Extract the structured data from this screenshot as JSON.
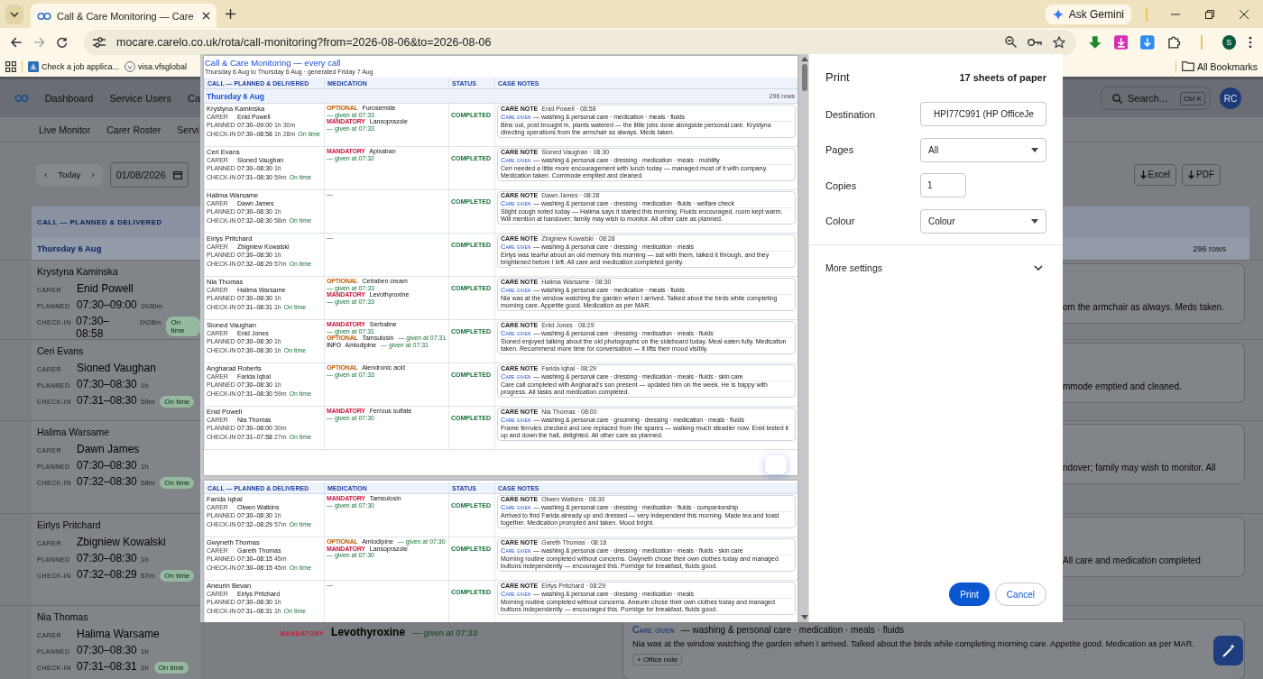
{
  "browser": {
    "tab_title": "Call & Care Monitoring — Care",
    "url": "mocare.carelo.co.uk/rota/call-monitoring?from=2026-08-06&to=2026-08-06",
    "ask_gemini": "Ask Gemini",
    "profile_initial": "S",
    "bookmarks": [
      "Check a job applica...",
      "visa.vfsglobal"
    ],
    "all_bookmarks": "All Bookmarks"
  },
  "app": {
    "nav": [
      "Dashboard",
      "Service Users",
      "Ca"
    ],
    "search": {
      "placeholder": "Search...",
      "shortcut": "Ctrl K"
    },
    "avatar": "RC",
    "subnav": [
      "Live Monitor",
      "Carer Roster",
      "Servi"
    ],
    "toolbar": {
      "prev": "‹",
      "today": "Today",
      "next": "›",
      "date": "01/08/2026",
      "exports": [
        "Excel",
        "PDF"
      ]
    },
    "column_header": "CALL — PLANNED & DELIVERED",
    "group": {
      "label": "Thursday 6 Aug",
      "count": "296 rows"
    },
    "rows": [
      {
        "client": "Krystyna Kaminska",
        "lines": [
          {
            "label": "CARER",
            "value": "Enid Powell"
          },
          {
            "label": "PLANNED",
            "value": "07:30–09:00",
            "duration": "1h30m"
          },
          {
            "label": "CHECK-IN",
            "value": "07:30–08:58",
            "duration": "1h28m",
            "badge": "On time"
          }
        ],
        "note_tail": "om the armchair as always. Meds taken."
      },
      {
        "client": "Ceri Evans",
        "lines": [
          {
            "label": "CARER",
            "value": "Sioned Vaughan"
          },
          {
            "label": "PLANNED",
            "value": "07:30–08:30",
            "duration": "1h"
          },
          {
            "label": "CHECK-IN",
            "value": "07:31–08:30",
            "duration": "59m",
            "badge": "On time"
          }
        ],
        "note_tail": "mmode emptied and cleaned."
      },
      {
        "client": "Halima Warsame",
        "lines": [
          {
            "label": "CARER",
            "value": "Dawn James"
          },
          {
            "label": "PLANNED",
            "value": "07:30–08:30",
            "duration": "1h"
          },
          {
            "label": "CHECK-IN",
            "value": "07:32–08:30",
            "duration": "58m",
            "badge": "On time"
          }
        ],
        "note_tail": "ndover; family may wish to monitor. All"
      },
      {
        "client": "Eirlys Pritchard",
        "lines": [
          {
            "label": "CARER",
            "value": "Zbigniew Kowalski"
          },
          {
            "label": "PLANNED",
            "value": "07:30–08:30",
            "duration": "1h"
          },
          {
            "label": "CHECK-IN",
            "value": "07:32–08:29",
            "duration": "57m",
            "badge": "On time"
          }
        ],
        "note_tail": "All care and medication completed"
      },
      {
        "client": "Nia Thomas",
        "lines": [
          {
            "label": "CARER",
            "value": "Halima Warsame"
          },
          {
            "label": "PLANNED",
            "value": "07:30–08:30",
            "duration": "1h"
          },
          {
            "label": "CHECK-IN",
            "value": "07:31–08:31",
            "duration": "1h",
            "badge": "On time"
          }
        ],
        "meds": [
          {
            "kind": "mandatory",
            "tag": "MANDATORY",
            "name": "Levothyroxine",
            "given": "— given at 07:33"
          }
        ],
        "note": {
          "given_label": "Care given",
          "given": "— washing & personal care · medication · meals · fluids",
          "text": "Nia was at the window watching the garden when I arrived. Talked about the birds while completing morning care. Appetite good. Medication as per MAR.",
          "action": "+ Office note"
        }
      }
    ]
  },
  "print_dialog": {
    "title": "Print",
    "sheets": "17 sheets of paper",
    "settings": [
      {
        "kind": "destination",
        "label": "Destination",
        "value": "HPI77C991 (HP OfficeJe"
      },
      {
        "kind": "select",
        "label": "Pages",
        "value": "All"
      },
      {
        "kind": "number",
        "label": "Copies",
        "value": "1"
      },
      {
        "kind": "select",
        "label": "Colour",
        "value": "Colour"
      }
    ],
    "more_settings": "More settings",
    "buttons": [
      {
        "kind": "primary",
        "label": "Print"
      },
      {
        "kind": "secondary",
        "label": "Cancel"
      }
    ],
    "pages": [
      {
        "title": "Call & Care Monitoring — every call",
        "subtitle": "Thursday 6 Aug to Thursday 6 Aug · generated Friday 7 Aug",
        "columns": [
          "CALL — PLANNED & DELIVERED",
          "MEDICATION",
          "STATUS",
          "CASE NOTES"
        ],
        "group": {
          "label": "Thursday 6 Aug",
          "count": "296 rows"
        },
        "floating_button": true,
        "rows": [
          {
            "client": "Krystyna Kaminska",
            "lines": [
              {
                "label": "CARER",
                "value": "Enid Powell"
              },
              {
                "label": "PLANNED",
                "value": "07:30–09:00",
                "duration": "1h 30m"
              },
              {
                "label": "CHECK-IN",
                "value": "07:30–08:58",
                "duration": "1h 28m",
                "badge": "On time"
              }
            ],
            "meds": [
              {
                "kind": "optional",
                "tag": "OPTIONAL",
                "name": "Furosemide",
                "given": "— given at 07:33"
              },
              {
                "kind": "mandatory",
                "tag": "MANDATORY",
                "name": "Lansoprazole",
                "given": "— given at 07:33"
              }
            ],
            "status": "COMPLETED",
            "note": {
              "heading": "CARE NOTE",
              "author": "Enid Powell · 08:58",
              "given_label": "Care given",
              "given": "— washing & personal care · medication · meals · fluids",
              "text": "Bins out, post brought in, plants watered — the little jobs done alongside personal care. Krystyna directing operations from the armchair as always. Meds taken."
            }
          },
          {
            "client": "Ceri Evans",
            "lines": [
              {
                "label": "CARER",
                "value": "Sioned Vaughan"
              },
              {
                "label": "PLANNED",
                "value": "07:30–08:30",
                "duration": "1h"
              },
              {
                "label": "CHECK-IN",
                "value": "07:31–08:30",
                "duration": "59m",
                "badge": "On time"
              }
            ],
            "meds": [
              {
                "kind": "mandatory",
                "tag": "MANDATORY",
                "name": "Apixaban",
                "given": "— given at 07:32"
              }
            ],
            "status": "COMPLETED",
            "note": {
              "heading": "CARE NOTE",
              "author": "Sioned Vaughan · 08:30",
              "given_label": "Care given",
              "given": "— washing & personal care · dressing · medication · meals · mobility",
              "text": "Ceri needed a little more encouragement with lunch today — managed most of it with company. Medication taken. Commode emptied and cleaned."
            }
          },
          {
            "client": "Halima Warsame",
            "lines": [
              {
                "label": "CARER",
                "value": "Dawn James"
              },
              {
                "label": "PLANNED",
                "value": "07:30–08:30",
                "duration": "1h"
              },
              {
                "label": "CHECK-IN",
                "value": "07:32–08:30",
                "duration": "58m",
                "badge": "On time"
              }
            ],
            "meds": [
              {
                "kind": "empty",
                "name": "—"
              }
            ],
            "status": "COMPLETED",
            "note": {
              "heading": "CARE NOTE",
              "author": "Dawn James · 08:28",
              "given_label": "Care given",
              "given": "— washing & personal care · dressing · medication · fluids · welfare check",
              "text": "Slight cough noted today — Halima says it started this morning. Fluids encouraged, room kept warm. Will mention at handover; family may wish to monitor. All other care as planned."
            }
          },
          {
            "client": "Eirlys Pritchard",
            "lines": [
              {
                "label": "CARER",
                "value": "Zbigniew Kowalski"
              },
              {
                "label": "PLANNED",
                "value": "07:30–08:30",
                "duration": "1h"
              },
              {
                "label": "CHECK-IN",
                "value": "07:32–08:29",
                "duration": "57m",
                "badge": "On time"
              }
            ],
            "meds": [
              {
                "kind": "empty",
                "name": "—"
              }
            ],
            "status": "COMPLETED",
            "note": {
              "heading": "CARE NOTE",
              "author": "Zbigniew Kowalski · 08:28",
              "given_label": "Care given",
              "given": "— washing & personal care · dressing · medication · meals",
              "text": "Eirlys was tearful about an old memory this morning — sat with them, talked it through, and they brightened before I left. All care and medication completed gently."
            }
          },
          {
            "client": "Nia Thomas",
            "lines": [
              {
                "label": "CARER",
                "value": "Halima Warsame"
              },
              {
                "label": "PLANNED",
                "value": "07:30–08:30",
                "duration": "1h"
              },
              {
                "label": "CHECK-IN",
                "value": "07:31–08:31",
                "duration": "1h",
                "badge": "On time"
              }
            ],
            "meds": [
              {
                "kind": "optional",
                "tag": "OPTIONAL",
                "name": "Cetraben cream",
                "given": "— given at 07:33"
              },
              {
                "kind": "mandatory",
                "tag": "MANDATORY",
                "name": "Levothyroxine",
                "given": "— given at 07:33"
              }
            ],
            "status": "COMPLETED",
            "note": {
              "heading": "CARE NOTE",
              "author": "Halima Warsame · 08:30",
              "given_label": "Care given",
              "given": "— washing & personal care · medication · meals · fluids",
              "text": "Nia was at the window watching the garden when I arrived. Talked about the birds while completing morning care. Appetite good. Medication as per MAR."
            }
          },
          {
            "client": "Sioned Vaughan",
            "lines": [
              {
                "label": "CARER",
                "value": "Enid Jones"
              },
              {
                "label": "PLANNED",
                "value": "07:30–08:30",
                "duration": "1h"
              },
              {
                "label": "CHECK-IN",
                "value": "07:30–08:30",
                "duration": "1h",
                "badge": "On time"
              }
            ],
            "meds": [
              {
                "kind": "mandatory",
                "tag": "MANDATORY",
                "name": "Sertraline",
                "given": "— given at 07:31"
              },
              {
                "kind": "optional",
                "tag": "OPTIONAL",
                "name": "Tamsulosin",
                "given": "— given at 07:31"
              },
              {
                "kind": "info",
                "tag": "INFO",
                "name": "Amlodipine",
                "given": "— given at 07:31"
              }
            ],
            "status": "COMPLETED",
            "note": {
              "heading": "CARE NOTE",
              "author": "Enid Jones · 08:29",
              "given_label": "Care given",
              "given": "— washing & personal care · dressing · medication · meals · fluids",
              "text": "Sioned enjoyed talking about the old photographs on the sideboard today. Meal eaten fully. Medication taken. Recommend more time for conversation — it lifts their mood visibly."
            }
          },
          {
            "client": "Angharad Roberts",
            "lines": [
              {
                "label": "CARER",
                "value": "Farida Iqbal"
              },
              {
                "label": "PLANNED",
                "value": "07:30–08:30",
                "duration": "1h"
              },
              {
                "label": "CHECK-IN",
                "value": "07:31–08:30",
                "duration": "59m",
                "badge": "On time"
              }
            ],
            "meds": [
              {
                "kind": "optional",
                "tag": "OPTIONAL",
                "name": "Alendronic acid",
                "given": "— given at 07:33"
              }
            ],
            "status": "COMPLETED",
            "note": {
              "heading": "CARE NOTE",
              "author": "Farida Iqbal · 08:29",
              "given_label": "Care given",
              "given": "— washing & personal care · dressing · medication · meals · fluids · skin care",
              "text": "Care call completed with Angharad's son present — updated him on the week. He is happy with progress. All tasks and medication completed."
            }
          },
          {
            "client": "Enid Powell",
            "lines": [
              {
                "label": "CARER",
                "value": "Nia Thomas"
              },
              {
                "label": "PLANNED",
                "value": "07:30–08:00",
                "duration": "30m"
              },
              {
                "label": "CHECK-IN",
                "value": "07:31–07:58",
                "duration": "27m",
                "badge": "On time"
              }
            ],
            "meds": [
              {
                "kind": "mandatory",
                "tag": "MANDATORY",
                "name": "Ferrous sulfate",
                "given": "— given at 07:30"
              }
            ],
            "status": "COMPLETED",
            "note": {
              "heading": "CARE NOTE",
              "author": "Nia Thomas · 08:00",
              "given_label": "Care given",
              "given": "— washing & personal care · grooming · dressing · medication · meals · fluids",
              "text": "Frame ferrules checked and one replaced from the spares — walking much steadier now. Enid tested it up and down the hall, delighted. All other care as planned."
            }
          }
        ]
      },
      {
        "columns": [
          "CALL — PLANNED & DELIVERED",
          "MEDICATION",
          "STATUS",
          "CASE NOTES"
        ],
        "floating_button": false,
        "rows": [
          {
            "client": "Farida Iqbal",
            "lines": [
              {
                "label": "CARER",
                "value": "Olwen Watkins"
              },
              {
                "label": "PLANNED",
                "value": "07:30–08:30",
                "duration": "1h"
              },
              {
                "label": "CHECK-IN",
                "value": "07:32–08:29",
                "duration": "57m",
                "badge": "On time"
              }
            ],
            "meds": [
              {
                "kind": "mandatory",
                "tag": "MANDATORY",
                "name": "Tamsulosin",
                "given": "— given at 07:30"
              }
            ],
            "status": "COMPLETED",
            "note": {
              "heading": "CARE NOTE",
              "author": "Olwen Watkins · 08:30",
              "given_label": "Care given",
              "given": "— washing & personal care · dressing · medication · fluids · companionship",
              "text": "Arrived to find Farida already up and dressed — very independent this morning. Made tea and toast together. Medication prompted and taken. Mood bright."
            }
          },
          {
            "client": "Gwyneth Thomas",
            "lines": [
              {
                "label": "CARER",
                "value": "Gareth Thomas"
              },
              {
                "label": "PLANNED",
                "value": "07:30–08:15",
                "duration": "45m"
              },
              {
                "label": "CHECK-IN",
                "value": "07:30–08:15",
                "duration": "45m",
                "badge": "On time"
              }
            ],
            "meds": [
              {
                "kind": "optional",
                "tag": "OPTIONAL",
                "name": "Amlodipine",
                "given": "— given at 07:30"
              },
              {
                "kind": "mandatory",
                "tag": "MANDATORY",
                "name": "Lansoprazole",
                "given": "— given at 07:30"
              }
            ],
            "status": "COMPLETED",
            "note": {
              "heading": "CARE NOTE",
              "author": "Gareth Thomas · 08:16",
              "given_label": "Care given",
              "given": "— washing & personal care · dressing · medication · meals · fluids · skin care",
              "text": "Morning routine completed without concerns. Gwyneth chose their own clothes today and managed buttons independently — encouraged this. Porridge for breakfast, fluids good."
            }
          },
          {
            "client": "Aneurin Bevan",
            "lines": [
              {
                "label": "CARER",
                "value": "Eirlys Pritchard"
              },
              {
                "label": "PLANNED",
                "value": "07:30–08:30",
                "duration": "1h"
              },
              {
                "label": "CHECK-IN",
                "value": "07:31–08:31",
                "duration": "1h",
                "badge": "On time"
              }
            ],
            "meds": [
              {
                "kind": "empty",
                "name": "—"
              }
            ],
            "status": "COMPLETED",
            "note": {
              "heading": "CARE NOTE",
              "author": "Eirlys Pritchard · 08:29",
              "given_label": "Care given",
              "given": "— washing & personal care · dressing · medication · meals",
              "text": "Morning routine completed without concerns. Aneurin chose their own clothes today and managed buttons independently — encouraged this. Porridge for breakfast, fluids good."
            }
          }
        ]
      }
    ]
  }
}
